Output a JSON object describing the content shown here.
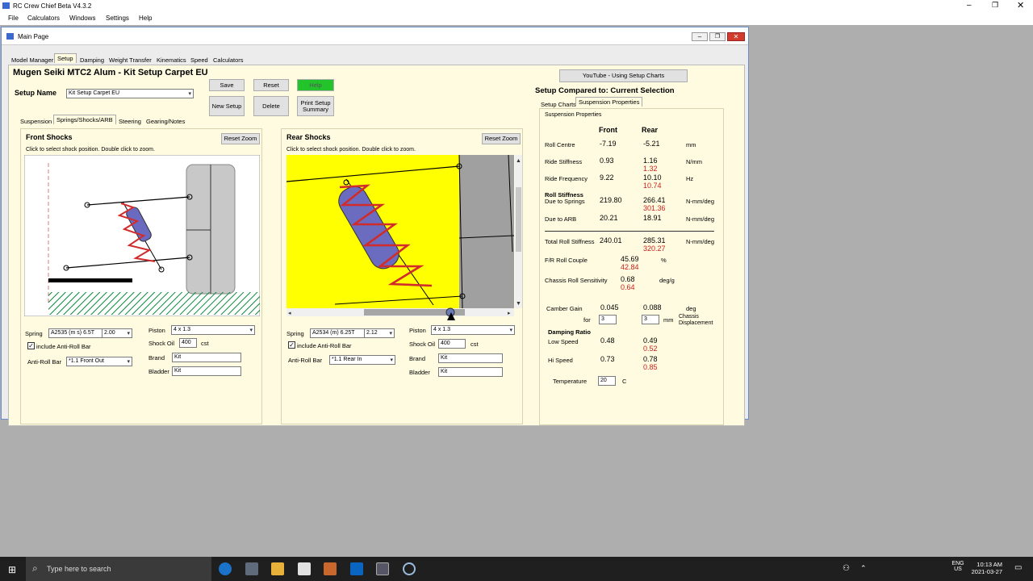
{
  "app": {
    "title": "RC Crew Chief Beta V4.3.2"
  },
  "menu": [
    "File",
    "Calculators",
    "Windows",
    "Settings",
    "Help"
  ],
  "window": {
    "title": "Main Page"
  },
  "main_tabs": [
    "Model Manager",
    "Setup",
    "Damping",
    "Weight Transfer",
    "Kinematics",
    "Speed",
    "Calculators"
  ],
  "setup": {
    "heading": "Mugen Seiki MTC2 Alum - Kit Setup Carpet EU",
    "name_label": "Setup Name",
    "name_value": "Kit Setup Carpet EU",
    "buttons": {
      "save": "Save",
      "reset": "Reset",
      "help": "Help",
      "new": "New Setup",
      "delete": "Delete",
      "print": "Print Setup Summary"
    }
  },
  "sub_tabs": [
    "Suspension",
    "Springs/Shocks/ARB",
    "Steering",
    "Gearing/Notes"
  ],
  "front": {
    "title": "Front Shocks",
    "hint": "Click to select shock position. Double click to zoom.",
    "reset_zoom": "Reset Zoom",
    "spring_label": "Spring",
    "spring_value": "A2535 (m s) 6.5T",
    "spring_rate": "2.00",
    "arb_check": "include Anti-Roll Bar",
    "arb_label": "Anti-Roll Bar",
    "arb_value": "*1.1 Front Out",
    "piston_label": "Piston",
    "piston_value": "4 x 1.3",
    "oil_label": "Shock Oil",
    "oil_value": "400",
    "oil_unit": "cst",
    "brand_label": "Brand",
    "brand_value": "Kit",
    "bladder_label": "Bladder",
    "bladder_value": "Kit"
  },
  "rear": {
    "title": "Rear Shocks",
    "hint": "Click to select shock position. Double click to zoom.",
    "reset_zoom": "Reset Zoom",
    "spring_label": "Spring",
    "spring_value": "A2534 (m) 6.25T",
    "spring_rate": "2.12",
    "arb_check": "include Anti-Roll Bar",
    "arb_label": "Anti-Roll Bar",
    "arb_value": "*1.1 Rear In",
    "piston_label": "Piston",
    "piston_value": "4 x 1.3",
    "oil_label": "Shock Oil",
    "oil_value": "400",
    "oil_unit": "cst",
    "brand_label": "Brand",
    "brand_value": "Kit",
    "bladder_label": "Bladder",
    "bladder_value": "Kit"
  },
  "right": {
    "youtube": "YouTube - Using Setup Charts",
    "compared": "Setup Compared to: Current Selection",
    "tabs": [
      "Setup Charts",
      "Suspension Properties"
    ],
    "group": "Suspension Properties",
    "front_hdr": "Front",
    "rear_hdr": "Rear",
    "roll_centre": {
      "label": "Roll Centre",
      "front": "-7.19",
      "rear": "-5.21",
      "unit": "mm"
    },
    "ride_stiffness": {
      "label": "Ride Stiffness",
      "front": "0.93",
      "rear": "1.16",
      "rear_cmp": "1.32",
      "unit": "N/mm"
    },
    "ride_frequency": {
      "label": "Ride Frequency",
      "front": "9.22",
      "rear": "10.10",
      "rear_cmp": "10.74",
      "unit": "Hz"
    },
    "roll_stiffness_hdr": "Roll Stiffness",
    "due_springs": {
      "label": "Due to Springs",
      "front": "219.80",
      "rear": "266.41",
      "rear_cmp": "301.36",
      "unit": "N-mm/deg"
    },
    "due_arb": {
      "label": "Due to ARB",
      "front": "20.21",
      "rear": "18.91",
      "unit": "N-mm/deg"
    },
    "total_roll": {
      "label": "Total Roll Stiffness",
      "front": "240.01",
      "rear": "285.31",
      "rear_cmp": "320.27",
      "unit": "N-mm/deg"
    },
    "fr_couple": {
      "label": "F/R Roll Couple",
      "value": "45.69",
      "cmp": "42.84",
      "unit": "%"
    },
    "chassis_sens": {
      "label": "Chassis Roll Sensitivity",
      "value": "0.68",
      "cmp": "0.64",
      "unit": "deg/g"
    },
    "camber_gain": {
      "label": "Camber Gain",
      "front": "0.045",
      "rear": "0.088",
      "unit": "deg"
    },
    "for_label": "for",
    "for_front": "3",
    "for_rear": "3",
    "for_unit": "mm",
    "chassis_disp": "Chassis Displacement",
    "damping_hdr": "Damping Ratio",
    "low_speed": {
      "label": "Low Speed",
      "front": "0.48",
      "rear": "0.49",
      "rear_cmp": "0.52"
    },
    "hi_speed": {
      "label": "Hi Speed",
      "front": "0.73",
      "rear": "0.78",
      "rear_cmp": "0.85"
    },
    "temp": {
      "label": "Temperature",
      "value": "20",
      "unit": "C"
    }
  },
  "taskbar": {
    "search": "Type here to search",
    "lang": "ENG",
    "region": "US",
    "time": "10:13 AM",
    "date": "2021-03-27"
  }
}
